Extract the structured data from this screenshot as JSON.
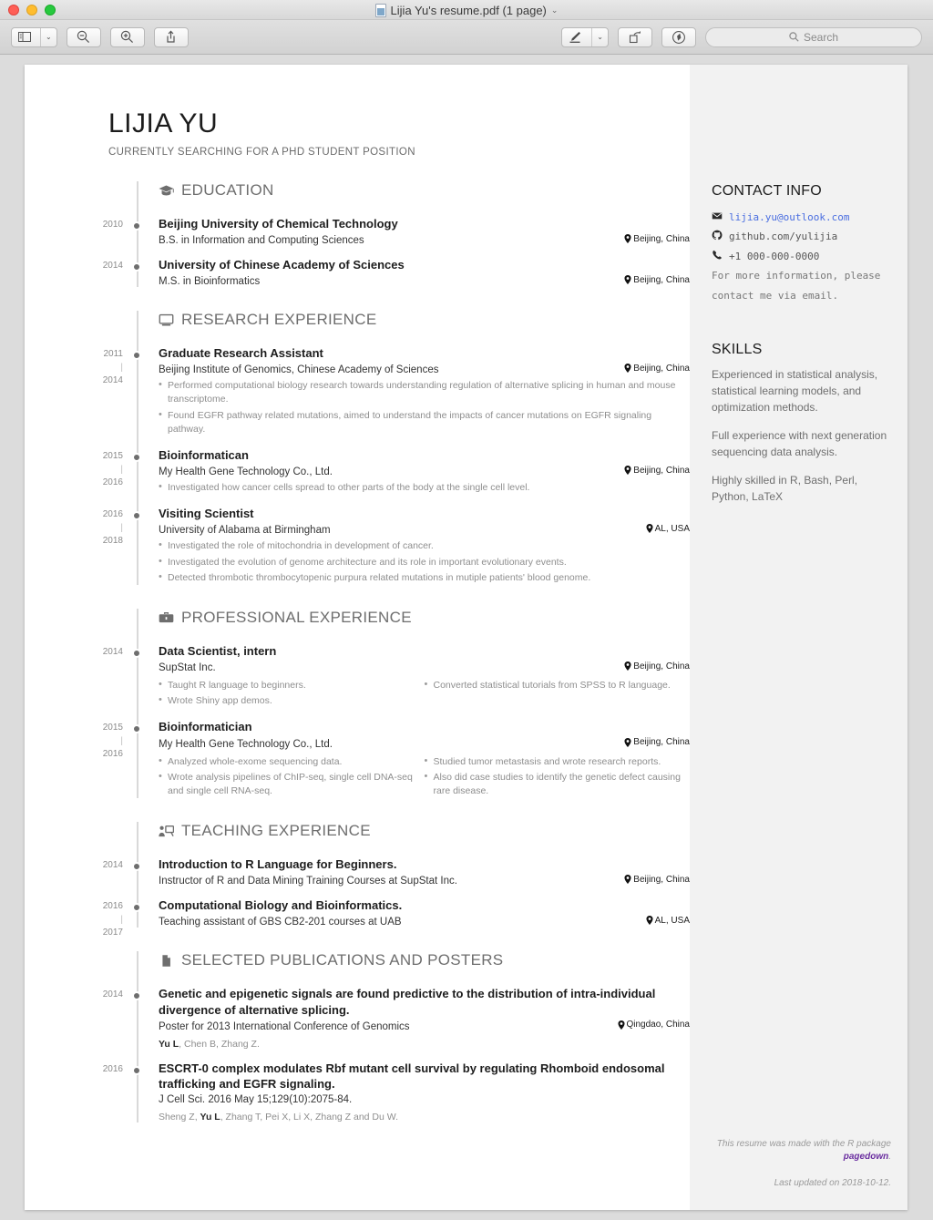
{
  "window": {
    "title": "Lijia Yu's resume.pdf (1 page)",
    "title_chevron": "⌄",
    "traffic_lights": [
      "close",
      "minimize",
      "zoom"
    ]
  },
  "toolbar": {
    "sidebar_button": "sidebar-view",
    "sidebar_chevron": "⌄",
    "zoom_out": "zoom-out",
    "zoom_in": "zoom-in",
    "share": "share",
    "markup": "markup-pen",
    "markup_chevron": "⌄",
    "rotate": "rotate",
    "annotate": "highlight",
    "search_placeholder": "Search"
  },
  "resume": {
    "name": "LIJIA YU",
    "tagline": "CURRENTLY SEARCHING FOR A PHD STUDENT POSITION",
    "sections": [
      {
        "id": "education",
        "icon": "graduation-cap-icon",
        "title": "EDUCATION",
        "entries": [
          {
            "years": [
              "2010"
            ],
            "role": "Beijing University of Chemical Technology",
            "org": "B.S. in Information and Computing Sciences",
            "location": "Beijing, China",
            "bullets_left": [],
            "bullets_right": []
          },
          {
            "years": [
              "2014"
            ],
            "role": "University of Chinese Academy of Sciences",
            "org": "M.S. in Bioinformatics",
            "location": "Beijing, China",
            "bullets_left": [],
            "bullets_right": []
          }
        ]
      },
      {
        "id": "research-experience",
        "icon": "desktop-icon",
        "title": "RESEARCH EXPERIENCE",
        "entries": [
          {
            "years": [
              "2011",
              "2014"
            ],
            "role": "Graduate Research Assistant",
            "org": "Beijing Institute of Genomics, Chinese Academy of Sciences",
            "location": "Beijing, China",
            "bullets_left": [
              "Performed computational biology research towards understanding regulation of alternative splicing in human and mouse transcriptome.",
              "Found EGFR pathway related mutations, aimed to understand the impacts of cancer mutations on EGFR signaling pathway."
            ],
            "bullets_right": []
          },
          {
            "years": [
              "2015",
              "2016"
            ],
            "role": "Bioinformatican",
            "org": "My Health Gene Technology Co., Ltd.",
            "location": "Beijing, China",
            "bullets_left": [
              "Investigated how cancer cells spread to other parts of the body at the single cell level."
            ],
            "bullets_right": []
          },
          {
            "years": [
              "2016",
              "2018"
            ],
            "role": "Visiting Scientist",
            "org": "University of Alabama at Birmingham",
            "location": "AL, USA",
            "bullets_left": [
              "Investigated the role of mitochondria in development of cancer.",
              "Investigated the evolution of genome architecture and its role in important evolutionary events.",
              "Detected thrombotic thrombocytopenic purpura related mutations in mutiple patients' blood genome."
            ],
            "bullets_right": []
          }
        ]
      },
      {
        "id": "professional-experience",
        "icon": "briefcase-icon",
        "title": "PROFESSIONAL EXPERIENCE",
        "entries": [
          {
            "years": [
              "2014"
            ],
            "role": "Data Scientist, intern",
            "org": "SupStat Inc.",
            "location": "Beijing, China",
            "bullets_left": [
              "Taught R language to beginners.",
              "Wrote Shiny app demos."
            ],
            "bullets_right": [
              "Converted statistical tutorials from SPSS to R language."
            ]
          },
          {
            "years": [
              "2015",
              "2016"
            ],
            "role": "Bioinformatician",
            "org": "My Health Gene Technology Co., Ltd.",
            "location": "Beijing, China",
            "bullets_left": [
              "Analyzed whole-exome sequencing data.",
              "Wrote analysis pipelines of ChIP-seq, single cell DNA-seq and single cell RNA-seq."
            ],
            "bullets_right": [
              "Studied tumor metastasis and wrote research reports.",
              "Also did case studies to identify the genetic defect causing rare disease."
            ]
          }
        ]
      },
      {
        "id": "teaching-experience",
        "icon": "chalkboard-teacher-icon",
        "title": "TEACHING EXPERIENCE",
        "entries": [
          {
            "years": [
              "2014"
            ],
            "role": "Introduction to R Language for Beginners.",
            "org": "Instructor of R and Data Mining Training Courses at SupStat Inc.",
            "location": "Beijing, China",
            "bullets_left": [],
            "bullets_right": []
          },
          {
            "years": [
              "2016",
              "2017"
            ],
            "role": "Computational Biology and Bioinformatics.",
            "org": "Teaching assistant of GBS CB2-201 courses at UAB",
            "location": "AL, USA",
            "bullets_left": [],
            "bullets_right": []
          }
        ]
      },
      {
        "id": "selected-publications",
        "icon": "file-icon",
        "title": "SELECTED PUBLICATIONS AND POSTERS",
        "entries": [
          {
            "years": [
              "2014"
            ],
            "role": "Genetic and epigenetic signals are found predictive to the distribution of intra-individual divergence of alternative splicing.",
            "org": "Poster for 2013 International Conference of Genomics",
            "location": "Qingdao, China",
            "authors_pre": "",
            "authors_bold": "Yu L",
            "authors_post": ", Chen B, Zhang Z.",
            "bullets_left": [],
            "bullets_right": []
          },
          {
            "years": [
              "2016"
            ],
            "role": "ESCRT-0 complex modulates Rbf mutant cell survival by regulating Rhomboid endosomal trafficking and EGFR signaling.",
            "org": "J Cell Sci. 2016 May 15;129(10):2075-84.",
            "location": "",
            "authors_pre": "Sheng Z, ",
            "authors_bold": "Yu L",
            "authors_post": ", Zhang T, Pei X, Li X, Zhang Z and Du W.",
            "bullets_left": [],
            "bullets_right": []
          }
        ]
      }
    ],
    "sidebar": {
      "contact_title": "CONTACT INFO",
      "email": "lijia.yu@outlook.com",
      "github": "github.com/yulijia",
      "phone": "+1 000-000-0000",
      "note": "For more information, please contact me via email.",
      "skills_title": "SKILLS",
      "skills": [
        "Experienced in statistical analysis, statistical learning models, and optimization methods.",
        "Full experience with next generation sequencing data analysis.",
        "Highly skilled in R, Bash, Perl, Python, LaTeX"
      ],
      "footer_note_pre": "This resume was made with the R package ",
      "footer_note_pkg": "pagedown",
      "footer_note_post": ".",
      "footer_updated": "Last updated on 2018-10-12."
    },
    "colors": {
      "link": "#4a6ee0",
      "sidebar_bg": "#f2f2f2",
      "rail": "#d9d9d9",
      "heading": "#6e6e6e",
      "pagedown": "#6b2fa0"
    }
  }
}
